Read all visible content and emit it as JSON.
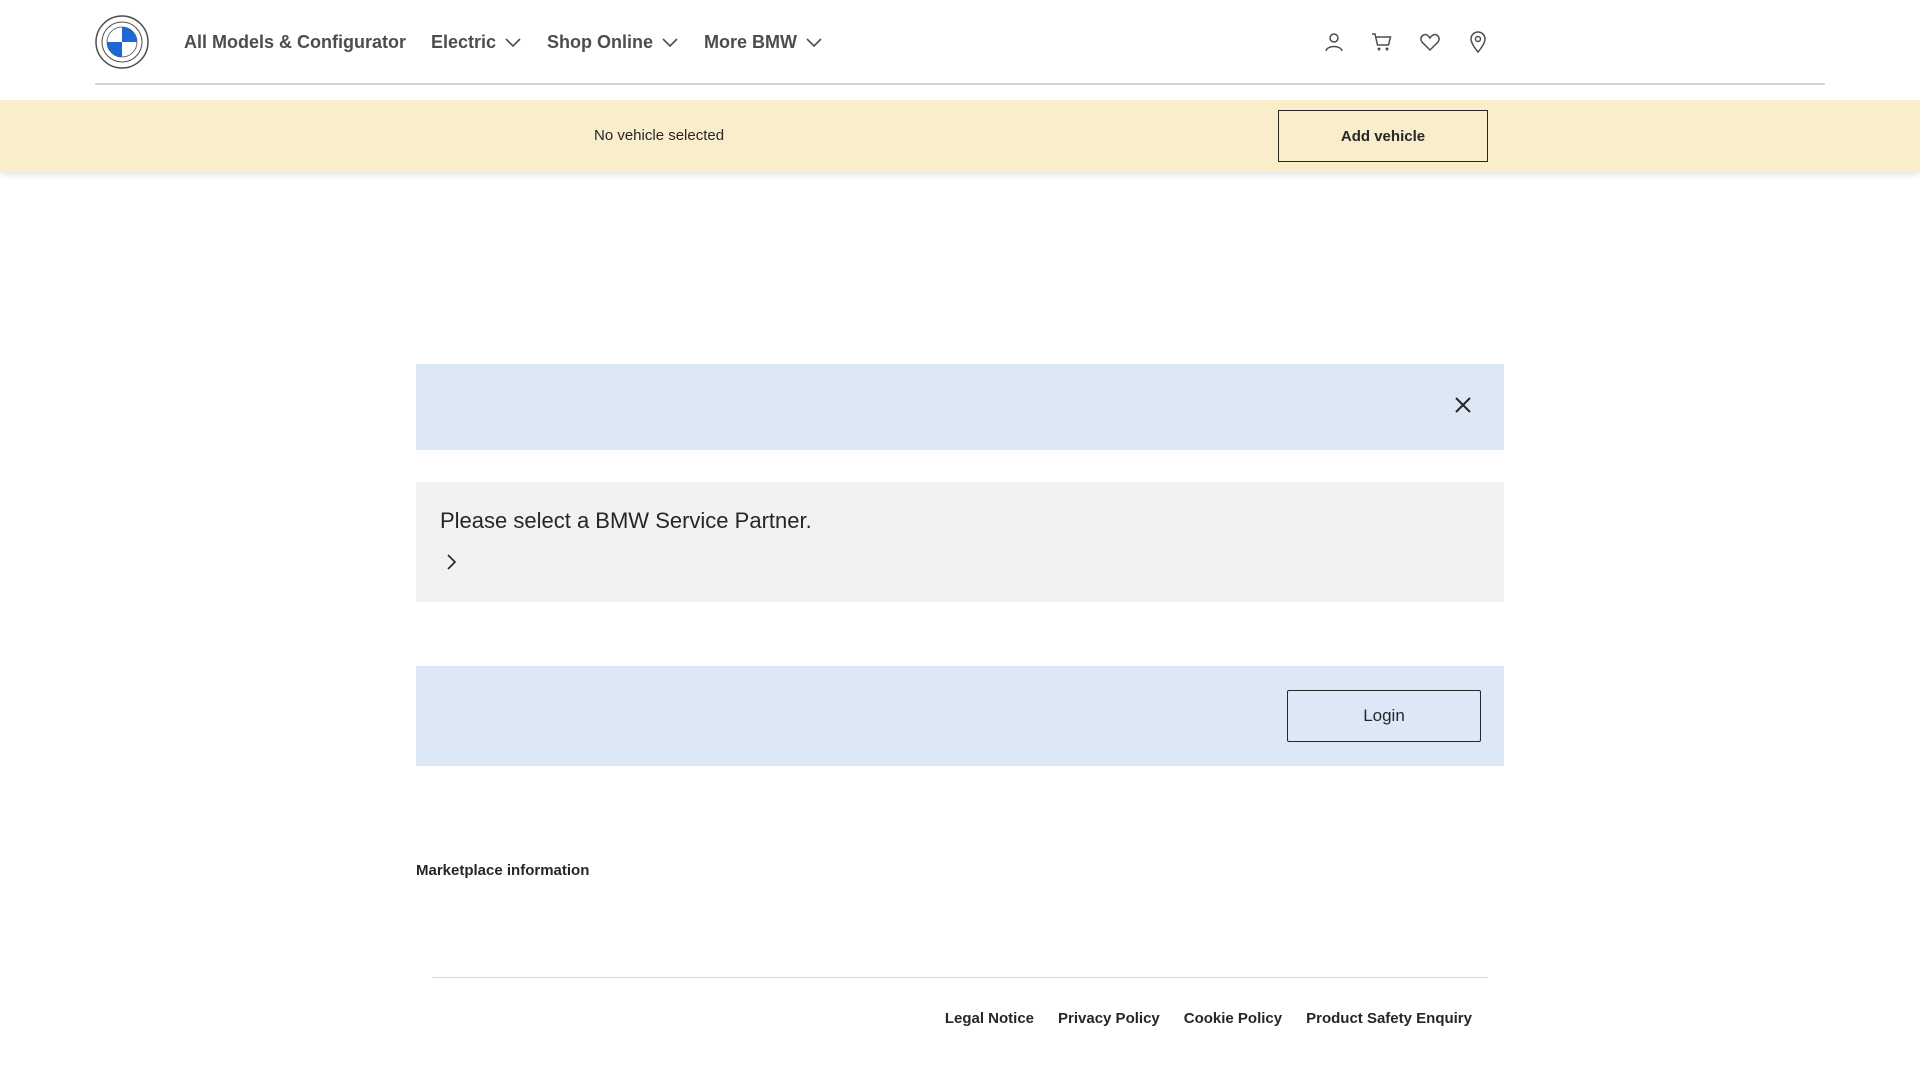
{
  "header": {
    "logo_text": "BMW",
    "nav": [
      {
        "label": "All Models & Configurator",
        "has_dropdown": false
      },
      {
        "label": "Electric",
        "has_dropdown": true
      },
      {
        "label": "Shop Online",
        "has_dropdown": true
      },
      {
        "label": "More BMW",
        "has_dropdown": true
      }
    ],
    "icons": [
      "user-icon",
      "cart-icon",
      "heart-icon",
      "location-pin-icon"
    ]
  },
  "vehicle_bar": {
    "status": "No vehicle selected",
    "button_label": "Add vehicle"
  },
  "info_banner": {
    "close_icon": "close-icon"
  },
  "service_partner": {
    "title": "Please select a BMW Service Partner.",
    "arrow_icon": "chevron-right-icon"
  },
  "login_banner": {
    "button_label": "Login"
  },
  "marketplace": {
    "label": "Marketplace information"
  },
  "footer": {
    "links": [
      "Legal Notice",
      "Privacy Policy",
      "Cookie Policy",
      "Product Safety Enquiry"
    ]
  },
  "colors": {
    "vehicle_bar_bg": "#faedcb",
    "info_banner_bg": "#dde8f7",
    "card_bg": "#f2f2f2",
    "bmw_blue": "#1c69d4"
  }
}
